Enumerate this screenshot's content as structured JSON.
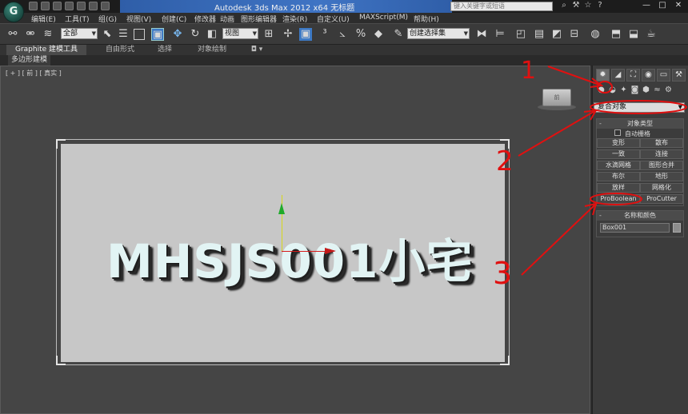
{
  "titlebar": {
    "logo": "G",
    "title": "Autodesk 3ds Max  2012 x64     无标题",
    "search_placeholder": "键入关键字或短语",
    "window_buttons": [
      "—",
      "□",
      "✕"
    ]
  },
  "menu": [
    "编辑(E)",
    "工具(T)",
    "组(G)",
    "视图(V)",
    "创建(C)",
    "修改器",
    "动画",
    "图形编辑器",
    "渲染(R)",
    "自定义(U)",
    "MAXScript(M)",
    "帮助(H)"
  ],
  "toolbar": {
    "selection_filter": "全部",
    "reference_coord": "视图",
    "named_selection": "创建选择集"
  },
  "ribbon": {
    "tabs": [
      "Graphite 建模工具",
      "自由形式",
      "选择",
      "对象绘制",
      "◘ ▾"
    ],
    "active_panel": "多边形建模"
  },
  "viewport": {
    "label": "[ + ] [ 前 ] [ 真实 ]",
    "viewcube_label": "前",
    "scene_text": "MHSJS001小宅"
  },
  "command_panel": {
    "category": "复合对象",
    "object_type": {
      "title": "对象类型",
      "autogrid": "自动栅格",
      "buttons": [
        [
          "变形",
          "散布"
        ],
        [
          "一致",
          "连接"
        ],
        [
          "水滴网格",
          "图形合并"
        ],
        [
          "布尔",
          "地形"
        ],
        [
          "放样",
          "网格化"
        ],
        [
          "ProBoolean",
          "ProCutter"
        ]
      ]
    },
    "name_color": {
      "title": "名称和颜色",
      "name": "Box001"
    }
  },
  "annotations": {
    "labels": [
      "1",
      "2",
      "3"
    ],
    "color": "#e01010"
  }
}
